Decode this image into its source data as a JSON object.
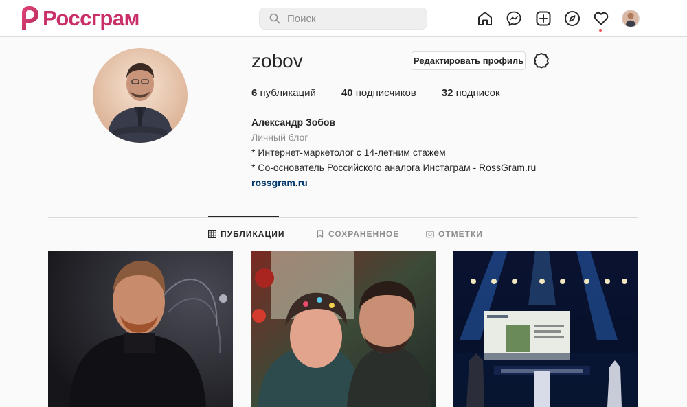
{
  "brand": {
    "name": "Россграм",
    "accent": "#c9306a"
  },
  "search": {
    "placeholder": "Поиск",
    "icon": "search-icon"
  },
  "nav": {
    "icons": [
      "home-icon",
      "messenger-icon",
      "new-post-icon",
      "explore-icon",
      "heart-icon",
      "avatar"
    ],
    "activity_dot_color": "#ed4956"
  },
  "profile": {
    "username": "zobov",
    "edit_label": "Редактировать профиль",
    "settings_icon": "gear-icon",
    "stats": {
      "posts_count": "6",
      "posts_label": " публикаций",
      "followers_count": "40",
      "followers_label": " подписчиков",
      "following_count": "32",
      "following_label": " подписок"
    },
    "bio": {
      "full_name": "Александр Зобов",
      "category": "Личный блог",
      "line1": "* Интернет-маркетолог с 14-летним стажем",
      "line2": "* Со-основатель Российского аналога Инстаграм - RossGram.ru",
      "link": "rossgram.ru"
    }
  },
  "tabs": [
    {
      "label": "ПУБЛИКАЦИИ",
      "icon": "grid-icon",
      "active": true
    },
    {
      "label": "СОХРАНЕННОЕ",
      "icon": "bookmark-icon",
      "active": false
    },
    {
      "label": "ОТМЕТКИ",
      "icon": "tagged-icon",
      "active": false
    }
  ],
  "posts": [
    {
      "alt": "portrait-man-dark-background"
    },
    {
      "alt": "couple-selfie-christmas"
    },
    {
      "alt": "stage-presentation-lights"
    }
  ]
}
